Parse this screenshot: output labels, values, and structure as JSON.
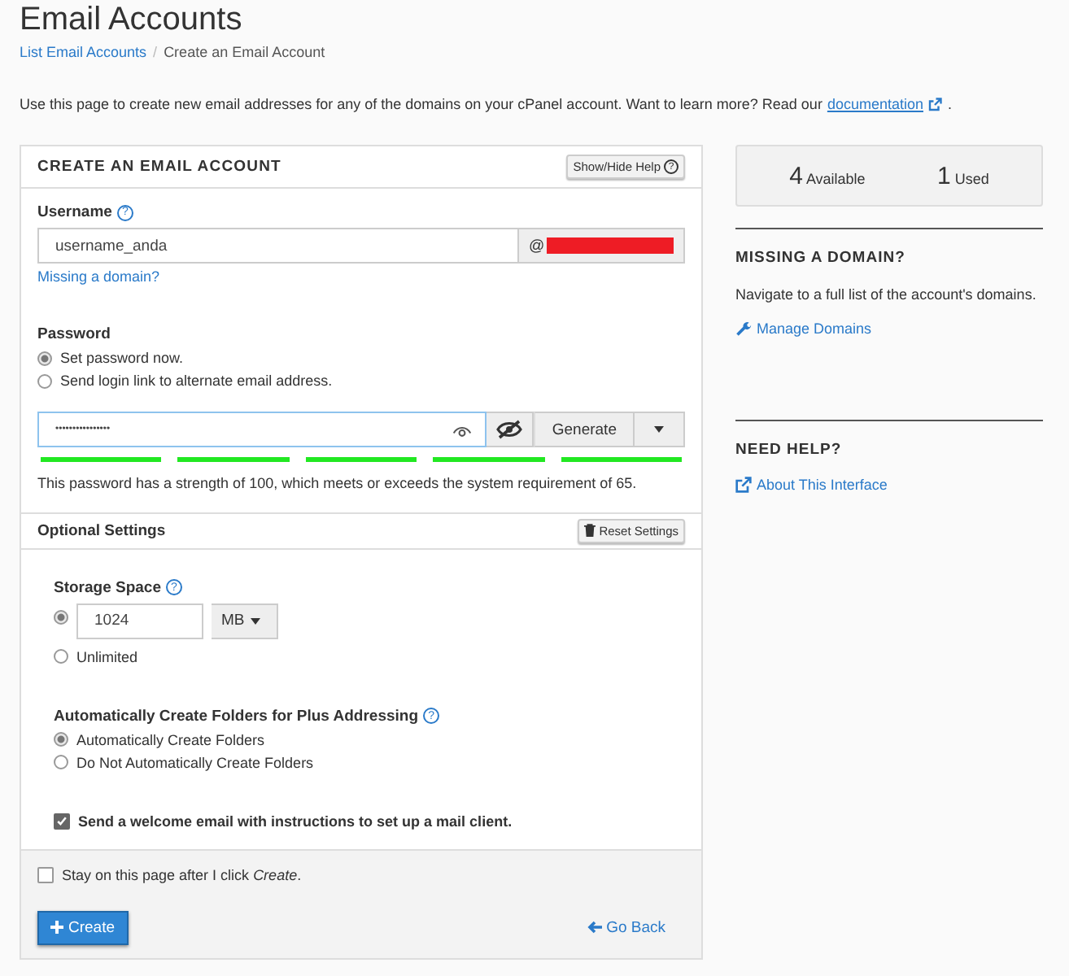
{
  "title": "Email Accounts",
  "breadcrumb": [
    {
      "kind": "link",
      "label": "List Email Accounts"
    },
    {
      "kind": "separator",
      "label": "/"
    },
    {
      "kind": "current",
      "label": "Create an Email Account"
    }
  ],
  "intro": {
    "text": "Use this page to create new email addresses for any of the domains on your cPanel account. Want to learn more? Read our",
    "link": "documentation",
    "after": "."
  },
  "panel": {
    "heading": "CREATE AN EMAIL ACCOUNT",
    "help_button": "Show/Hide Help",
    "help_button_icon": "?",
    "username": {
      "label": "Username",
      "help": "?",
      "value": "username_anda",
      "at": "@",
      "missing_link": "Missing a domain?"
    },
    "password": {
      "label": "Password",
      "options": [
        {
          "label": "Set password now.",
          "selected": true
        },
        {
          "label": "Send login link to alternate email address.",
          "selected": false
        }
      ],
      "value": "••••••••••••••••",
      "generate": "Generate",
      "strength": {
        "level": 1
      },
      "strength_text": "This password has a strength of 100, which meets or exceeds the system requirement of 65."
    },
    "optional": {
      "heading": "Optional Settings",
      "reset_button": "Reset Settings",
      "storage": {
        "label": "Storage Space",
        "help": "?",
        "options": [
          {
            "kind": "quota",
            "value": "1024",
            "unit": "MB",
            "selected": true
          },
          {
            "kind": "plain",
            "label": "Unlimited",
            "selected": false
          }
        ]
      },
      "folders": {
        "label": "Automatically Create Folders for Plus Addressing",
        "help": "?",
        "options": [
          {
            "label": "Automatically Create Folders",
            "selected": true
          },
          {
            "label": "Do Not Automatically Create Folders",
            "selected": false
          }
        ]
      },
      "welcome": {
        "label": "Send a welcome email with instructions to set up a mail client.",
        "checked": true
      }
    },
    "footer": {
      "stay": {
        "label": "Stay on this page after I click *Create*.",
        "checked": false
      },
      "create_button": "Create",
      "back_link": "Go Back"
    }
  },
  "stats": [
    {
      "number": "4",
      "label": "Available"
    },
    {
      "number": "1",
      "label": "Used"
    }
  ],
  "missing_domain": {
    "heading": "MISSING A DOMAIN?",
    "text": "Navigate to a full list of the account's domains.",
    "link": "Manage Domains"
  },
  "need_help": {
    "heading": "NEED HELP?",
    "link": "About This Interface"
  }
}
